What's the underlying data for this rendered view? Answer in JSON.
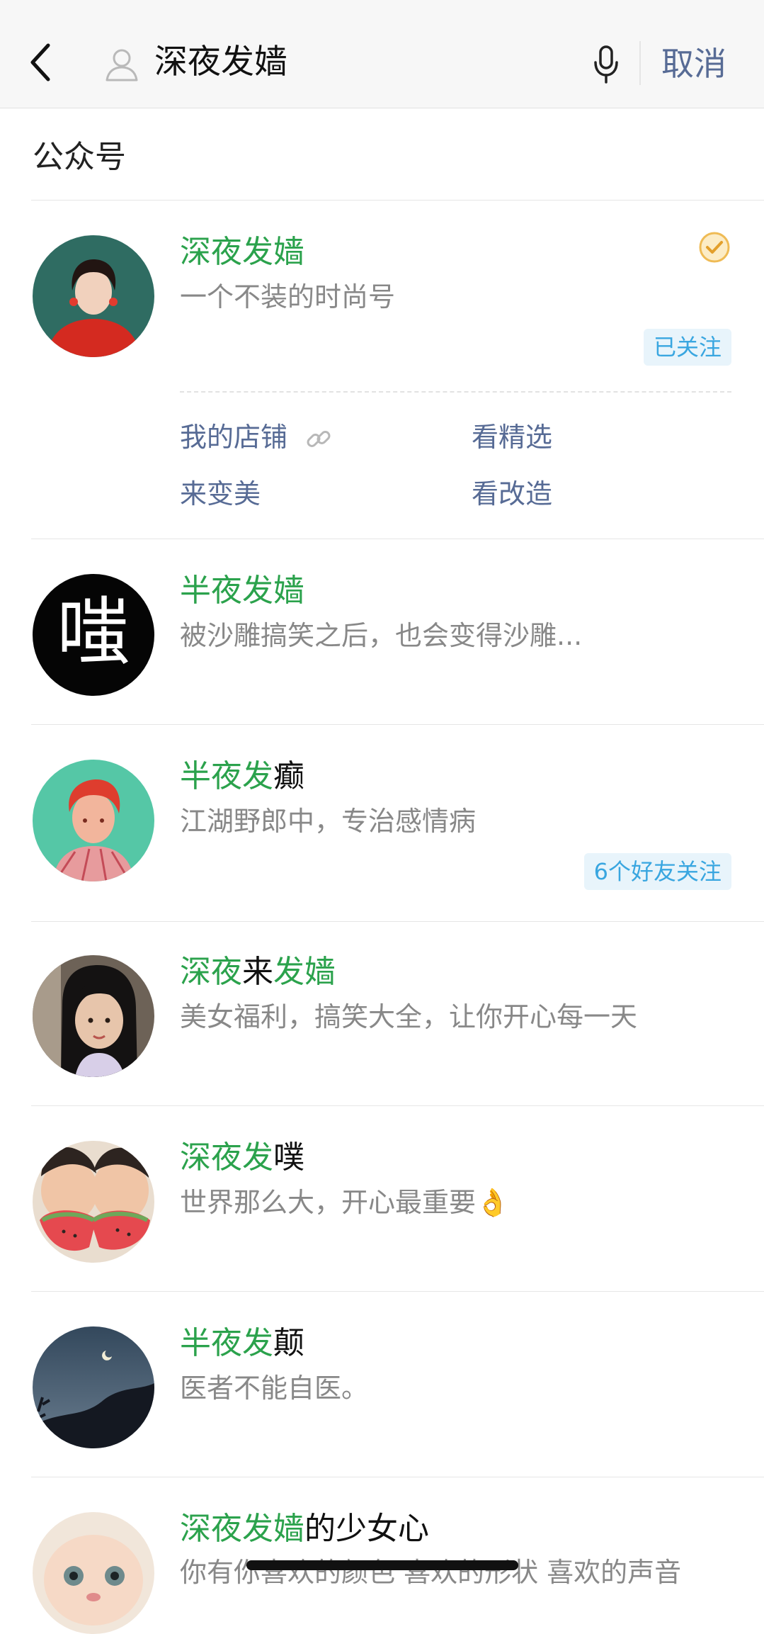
{
  "header": {
    "query": "深夜发嫱",
    "cancel_label": "取消"
  },
  "section_title": "公众号",
  "results": [
    {
      "name_parts": [
        {
          "text": "深夜发嫱",
          "hl": true
        }
      ],
      "desc": "一个不装的时尚号",
      "tag": "已关注",
      "verified": true,
      "menu": [
        {
          "label": "我的店铺",
          "link": true
        },
        {
          "label": "看精选",
          "link": false
        },
        {
          "label": "来变美",
          "link": false
        },
        {
          "label": "看改造",
          "link": false
        }
      ]
    },
    {
      "name_parts": [
        {
          "text": "半夜发嫱",
          "hl": true
        }
      ],
      "desc": "被沙雕搞笑之后，也会变得沙雕...",
      "avatar_glyph": "嗤"
    },
    {
      "name_parts": [
        {
          "text": "半夜发",
          "hl": true
        },
        {
          "text": "癫",
          "hl": false
        }
      ],
      "desc": "江湖野郎中，专治感情病",
      "tag": "6个好友关注"
    },
    {
      "name_parts": [
        {
          "text": "深夜",
          "hl": true
        },
        {
          "text": "来",
          "hl": false
        },
        {
          "text": "发嫱",
          "hl": true
        }
      ],
      "desc": "美女福利，搞笑大全，让你开心每一天"
    },
    {
      "name_parts": [
        {
          "text": "深夜发",
          "hl": true
        },
        {
          "text": "噗",
          "hl": false
        }
      ],
      "desc": "世界那么大，开心最重要👌"
    },
    {
      "name_parts": [
        {
          "text": "半夜发",
          "hl": true
        },
        {
          "text": "颠",
          "hl": false
        }
      ],
      "desc": "医者不能自医。"
    },
    {
      "name_parts": [
        {
          "text": "深夜发嫱",
          "hl": true
        },
        {
          "text": "的少女心",
          "hl": false
        }
      ],
      "desc": "你有你喜欢的颜色 喜欢的形状 喜欢的声音"
    }
  ]
}
